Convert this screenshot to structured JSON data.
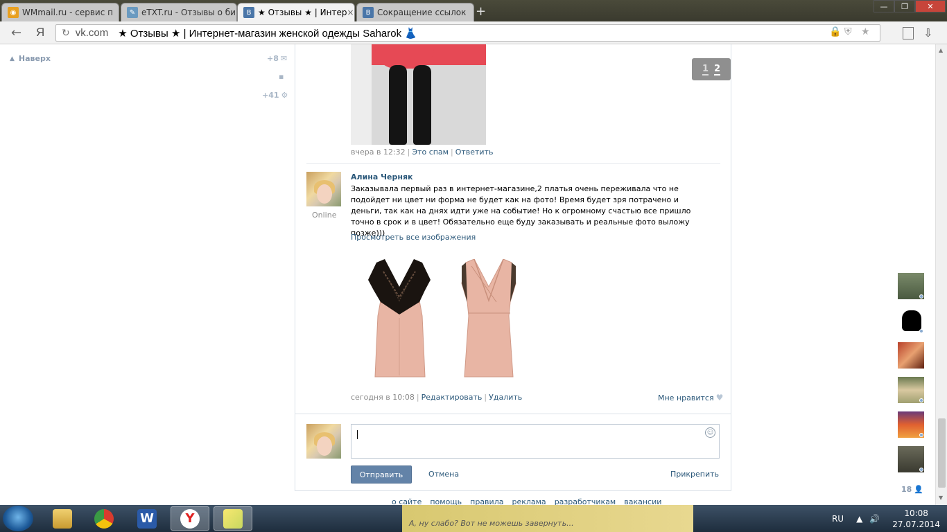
{
  "browser": {
    "tabs": [
      {
        "title": "WMmail.ru - сервис п",
        "favicon_color": "#e8a020"
      },
      {
        "title": "eTXT.ru - Отзывы о би",
        "favicon_color": "#6a9ac0"
      },
      {
        "title": "★ Отзывы ★ | Интер",
        "favicon_color": "#4a76a8",
        "favicon_letter": "B"
      },
      {
        "title": "Сокращение ссылок",
        "favicon_color": "#4a76a8",
        "favicon_letter": "B"
      }
    ],
    "tab_close": "×",
    "new_tab": "+",
    "window_controls": {
      "minimize": "—",
      "restore": "❐",
      "close": "✕"
    },
    "nav_back": "←",
    "yandex_logo": "Я",
    "address": {
      "reload": "↻",
      "domain": "vk.com",
      "page_title": "★ Отзывы ★ | Интернет-магазин женской одежды Saharok 👗"
    },
    "address_icons": {
      "lock": "🔒",
      "shield": "⛨",
      "star": "★"
    }
  },
  "left_panel": {
    "top_link": "Наверх",
    "counters": [
      {
        "value": "+8",
        "icon": "mail-icon",
        "glyph": "✉"
      },
      {
        "value": "",
        "icon": "chat-icon",
        "glyph": "▪"
      },
      {
        "value": "+41",
        "icon": "gear-icon",
        "glyph": "⚙"
      }
    ]
  },
  "pager": {
    "pages": [
      "1",
      "2"
    ],
    "current": "2"
  },
  "posts": [
    {
      "time": "вчера в 12:32",
      "actions": [
        "Это спам",
        "Ответить"
      ]
    },
    {
      "author": "Алина Черняк",
      "status": "Online",
      "text": "Заказывала первый раз в интернет-магазине,2 платья очень переживала что не подойдет ни цвет ни форма не будет как на фото! Время будет зря потрачено и деньги, так как на днях идти уже на событие! Но к огромному счастью все пришло точно в срок и в цвет! Обязательно еще буду заказывать и реальные фото выложу позже)))",
      "view_all": "Просмотреть все изображения",
      "time": "сегодня в 10:08",
      "actions": [
        "Редактировать",
        "Удалить"
      ],
      "like_label": "Мне нравится"
    }
  ],
  "reply": {
    "send": "Отправить",
    "cancel": "Отмена",
    "attach": "Прикрепить"
  },
  "footer": [
    "о сайте",
    "помощь",
    "правила",
    "реклама",
    "разработчикам",
    "вакансии"
  ],
  "friends": {
    "count": "18"
  },
  "taskbar": {
    "lang": "RU",
    "time": "10:08",
    "date": "27.07.2014",
    "banner_text": "А, ну слабо? Вот не можешь завернуть..."
  },
  "colors": {
    "vk_link": "#2b587a",
    "vk_button": "#6383a8",
    "dress_pink": "#e8b5a4",
    "lace_black": "#1a1410"
  }
}
